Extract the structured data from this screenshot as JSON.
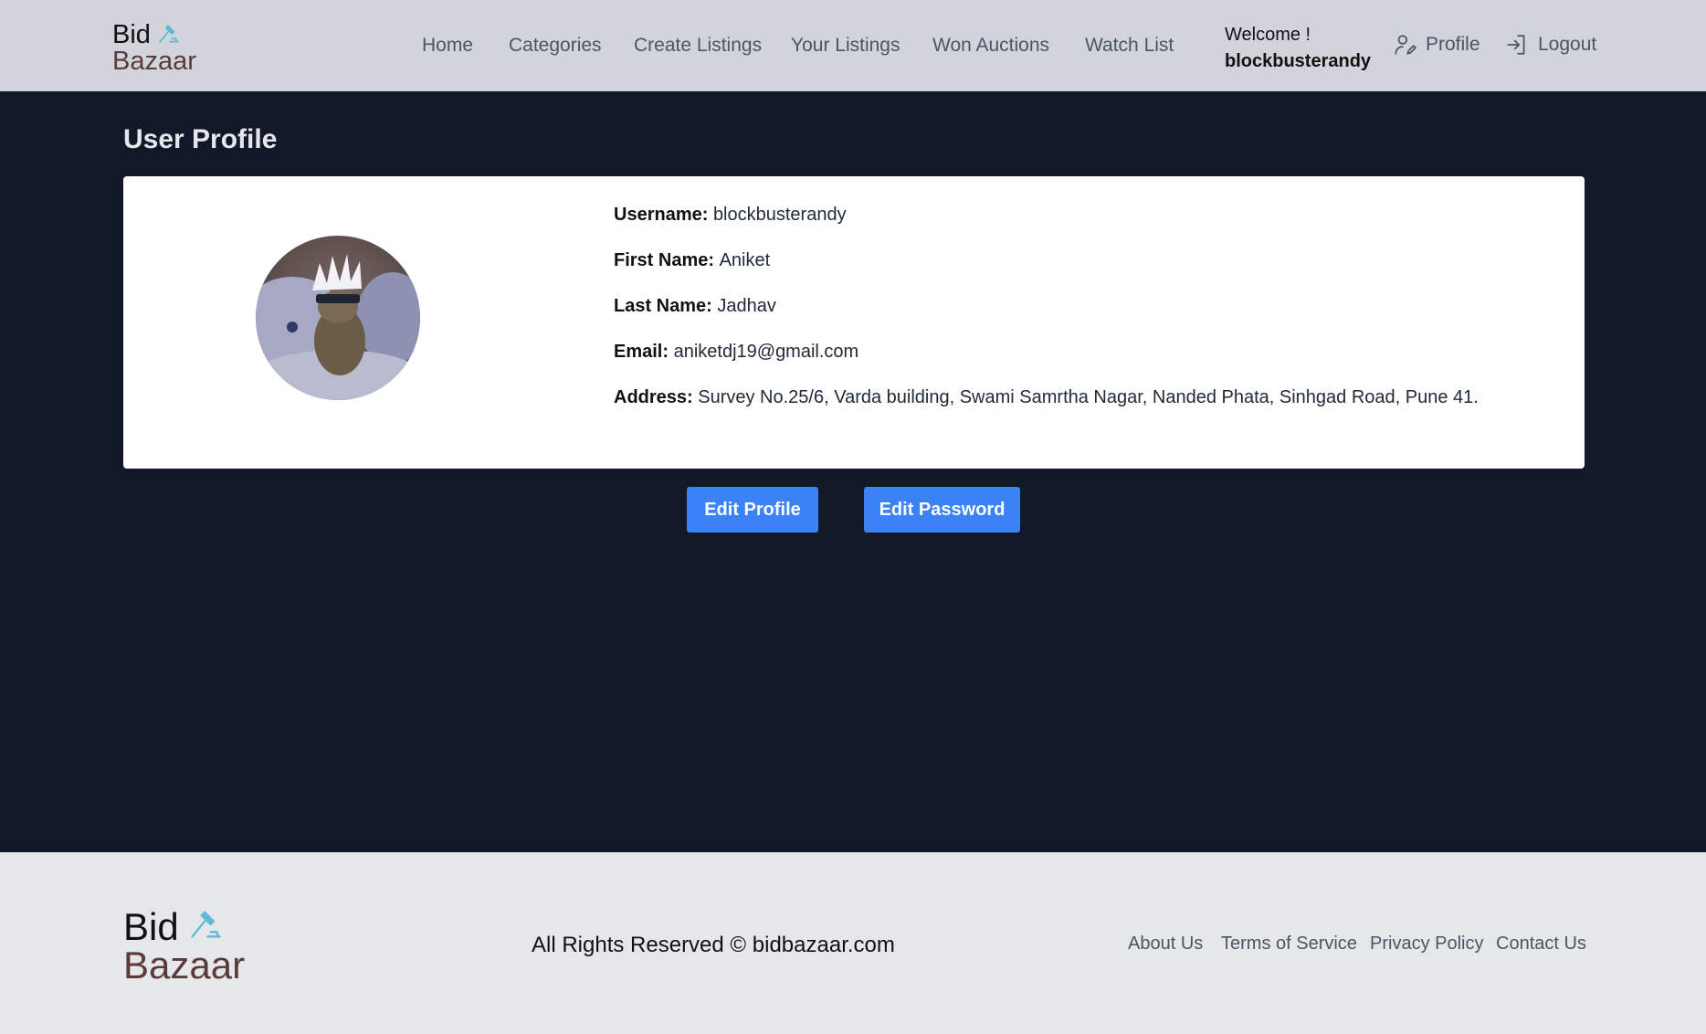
{
  "brand": {
    "line1": "Bid",
    "line2": "Bazaar"
  },
  "nav": {
    "items": [
      {
        "label": "Home"
      },
      {
        "label": "Categories"
      },
      {
        "label": "Create Listings"
      },
      {
        "label": "Your Listings"
      },
      {
        "label": "Won Auctions"
      },
      {
        "label": "Watch List"
      }
    ]
  },
  "header": {
    "welcome": "Welcome !",
    "username": "blockbusterandy",
    "profile_label": "Profile",
    "logout_label": "Logout",
    "profile_icon": "user-edit-icon",
    "logout_icon": "login-arrow-icon"
  },
  "main": {
    "title": "User Profile",
    "fields": [
      {
        "label": "Username:",
        "value": "blockbusterandy"
      },
      {
        "label": "First Name:",
        "value": "Aniket"
      },
      {
        "label": "Last Name:",
        "value": "Jadhav"
      },
      {
        "label": "Email:",
        "value": "aniketdj19@gmail.com"
      },
      {
        "label": "Address:",
        "value": "Survey No.25/6, Varda building, Swami Samrtha Nagar, Nanded Phata, Sinhgad Road, Pune 41."
      }
    ],
    "edit_profile_label": "Edit Profile",
    "edit_password_label": "Edit Password"
  },
  "footer": {
    "copyright": "All Rights Reserved © bidbazaar.com",
    "links": [
      {
        "label": "About Us"
      },
      {
        "label": "Terms of Service"
      },
      {
        "label": "Privacy Policy"
      },
      {
        "label": "Contact Us"
      }
    ]
  },
  "colors": {
    "header_bg": "#d1d5db",
    "page_bg": "#111827",
    "footer_bg": "#e5e7eb",
    "button": "#3b82f6",
    "brand_accent": "#5b3a3a",
    "gavel": "#5bb8d8"
  }
}
